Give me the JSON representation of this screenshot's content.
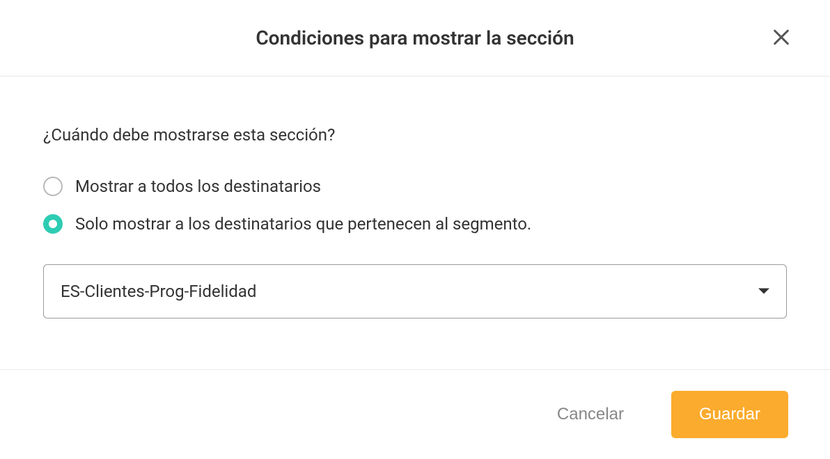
{
  "modal": {
    "title": "Condiciones para mostrar la sección",
    "question": "¿Cuándo debe mostrarse esta sección?",
    "options": {
      "all": "Mostrar a todos los destinatarios",
      "segment": "Solo mostrar a los destinatarios que pertenecen al segmento."
    },
    "select": {
      "value": "ES-Clientes-Prog-Fidelidad"
    },
    "footer": {
      "cancel": "Cancelar",
      "save": "Guardar"
    }
  }
}
